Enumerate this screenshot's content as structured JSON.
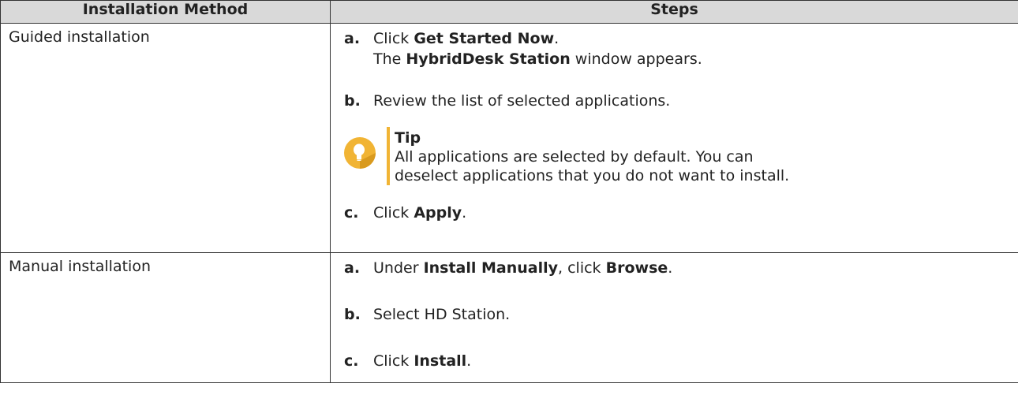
{
  "header": {
    "col1": "Installation Method",
    "col2": "Steps"
  },
  "guided": {
    "method": "Guided installation",
    "a_letter": "a.",
    "a_pre": "Click ",
    "a_bold": "Get Started Now",
    "a_post": ".",
    "a2_pre": "The ",
    "a2_bold": "HybridDesk Station",
    "a2_post": " window appears.",
    "b_letter": "b.",
    "b_text": "Review the list of selected applications.",
    "tip_title": "Tip",
    "tip_line1": "All applications are selected by default. You can",
    "tip_line2": "deselect applications that you do not want to install.",
    "c_letter": "c.",
    "c_pre": "Click ",
    "c_bold": "Apply",
    "c_post": "."
  },
  "manual": {
    "method": "Manual installation",
    "a_letter": "a.",
    "a_pre": "Under ",
    "a_bold1": "Install Manually",
    "a_mid": ", click ",
    "a_bold2": "Browse",
    "a_post": ".",
    "b_letter": "b.",
    "b_text": "Select HD Station.",
    "c_letter": "c.",
    "c_pre": "Click ",
    "c_bold": "Install",
    "c_post": "."
  },
  "colors": {
    "header_bg": "#d9d9d9",
    "tip_accent": "#f1b434"
  },
  "icons": {
    "tip": "lightbulb-icon"
  }
}
